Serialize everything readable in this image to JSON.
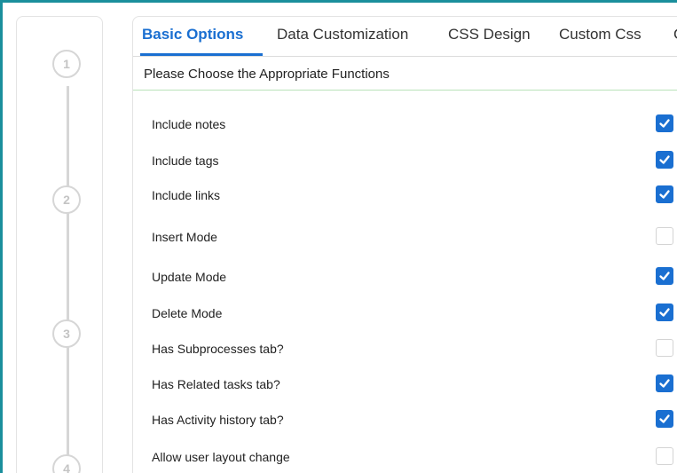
{
  "stepper": {
    "steps": [
      "1",
      "2",
      "3",
      "4"
    ]
  },
  "tabs": [
    {
      "label": "Basic Options",
      "active": true
    },
    {
      "label": "Data Customization",
      "active": false
    },
    {
      "label": "CSS Design",
      "active": false
    },
    {
      "label": "Custom Css",
      "active": false
    },
    {
      "label": "C",
      "active": false
    }
  ],
  "section": {
    "title": "Please Choose the Appropriate Functions"
  },
  "options": [
    {
      "label": "Include notes",
      "checked": true
    },
    {
      "label": "Include tags",
      "checked": true
    },
    {
      "label": "Include links",
      "checked": true
    },
    {
      "label": "Insert Mode",
      "checked": false
    },
    {
      "label": "Update Mode",
      "checked": true
    },
    {
      "label": "Delete Mode",
      "checked": true
    },
    {
      "label": "Has Subprocesses tab?",
      "checked": false
    },
    {
      "label": "Has Related tasks tab?",
      "checked": true
    },
    {
      "label": "Has Activity history tab?",
      "checked": true
    },
    {
      "label": "Allow user layout change",
      "checked": false
    }
  ],
  "colors": {
    "accent": "#1a6fd1",
    "frame": "#1a8f9c",
    "section_rule": "#b9e2b9"
  }
}
